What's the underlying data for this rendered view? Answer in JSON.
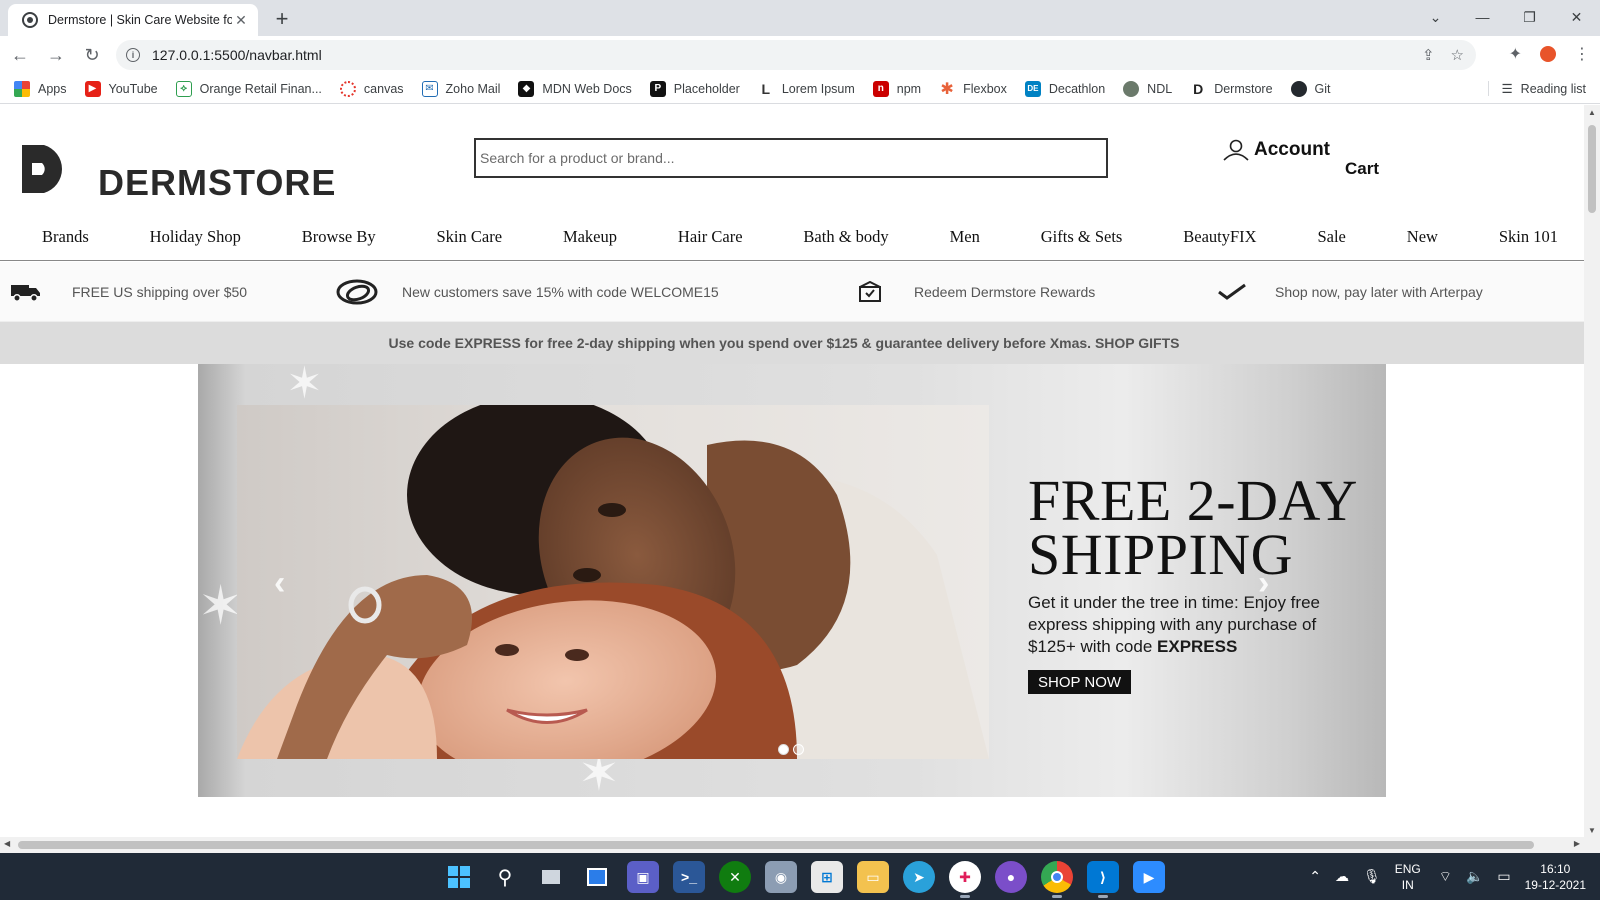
{
  "browser": {
    "tab_title": "Dermstore | Skin Care Website fo",
    "url": "127.0.0.1:5500/navbar.html",
    "bookmarks": [
      "Apps",
      "YouTube",
      "Orange Retail Finan...",
      "canvas",
      "Zoho Mail",
      "MDN Web Docs",
      "Placeholder",
      "Lorem Ipsum",
      "npm",
      "Flexbox",
      "Decathlon",
      "NDL",
      "Dermstore",
      "Git"
    ],
    "reading_list": "Reading list"
  },
  "header": {
    "brand": "DERMSTORE",
    "search_placeholder": "Search for a product or brand...",
    "account": "Account",
    "cart": "Cart"
  },
  "nav": [
    "Brands",
    "Holiday Shop",
    "Browse By",
    "Skin Care",
    "Makeup",
    "Hair Care",
    "Bath & body",
    "Men",
    "Gifts & Sets",
    "BeautyFIX",
    "Sale",
    "New",
    "Skin 101"
  ],
  "perks": [
    "FREE US shipping over $50",
    "New customers save 15% with code WELCOME15",
    "Redeem Dermstore Rewards",
    "Shop now, pay later with Arterpay"
  ],
  "promo": "Use code EXPRESS for free 2-day shipping when you spend over $125 & guarantee delivery before Xmas. SHOP GIFTS",
  "hero": {
    "title_line1": "FREE 2-DAY",
    "title_line2": "SHIPPING",
    "copy_main": "Get it under the tree in time: Enjoy free express shipping with any purchase of $125+ with code ",
    "copy_code": "EXPRESS",
    "cta": "SHOP NOW",
    "active_slide": 1,
    "slide_count": 2
  },
  "taskbar": {
    "lang_line1": "ENG",
    "lang_line2": "IN",
    "time": "16:10",
    "date": "19-12-2021"
  }
}
